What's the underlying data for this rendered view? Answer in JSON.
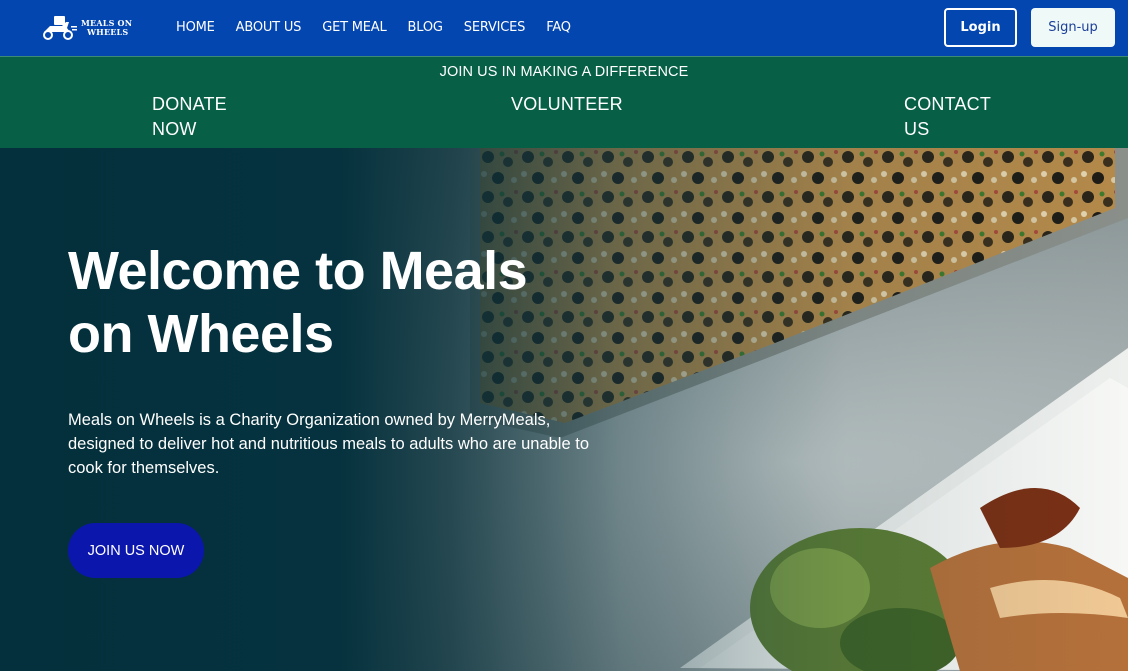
{
  "brand": {
    "logo_line1": "MEALS ON",
    "logo_line2": "WHEELS"
  },
  "nav": {
    "items": [
      {
        "label": "HOME"
      },
      {
        "label": "ABOUT US"
      },
      {
        "label": "GET MEAL"
      },
      {
        "label": "BLOG"
      },
      {
        "label": "SERVICES"
      },
      {
        "label": "FAQ"
      }
    ],
    "login_label": "Login",
    "signup_label": "Sign-up"
  },
  "banner": {
    "title": "JOIN US IN MAKING A DIFFERENCE",
    "links": [
      {
        "label": "DONATE NOW"
      },
      {
        "label": "VOLUNTEER"
      },
      {
        "label": "CONTACT US"
      }
    ]
  },
  "hero": {
    "title": "Welcome to Meals on Wheels",
    "description": "Meals on Wheels is a Charity Organization owned by MerryMeals, designed to deliver hot and nutritious meals to adults who are unable to cook for themselves.",
    "cta_label": "JOIN US NOW"
  },
  "colors": {
    "nav_bg": "#0446b0",
    "banner_bg": "#075f46",
    "hero_overlay": "#03303c",
    "cta_bg": "#0b16ad",
    "signup_bg": "#eef9f8"
  }
}
